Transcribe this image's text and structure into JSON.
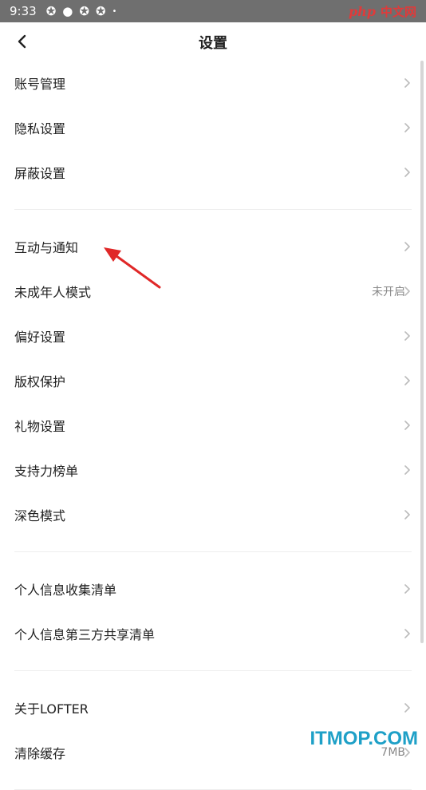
{
  "status": {
    "time": "9:33",
    "dot": "•",
    "watermark_left": "php",
    "watermark_right": "中文网"
  },
  "header": {
    "title": "设置"
  },
  "groups": [
    [
      {
        "label": "账号管理",
        "value": ""
      },
      {
        "label": "隐私设置",
        "value": ""
      },
      {
        "label": "屏蔽设置",
        "value": ""
      }
    ],
    [
      {
        "label": "互动与通知",
        "value": ""
      },
      {
        "label": "未成年人模式",
        "value": "未开启"
      },
      {
        "label": "偏好设置",
        "value": ""
      },
      {
        "label": "版权保护",
        "value": ""
      },
      {
        "label": "礼物设置",
        "value": ""
      },
      {
        "label": "支持力榜单",
        "value": ""
      },
      {
        "label": "深色模式",
        "value": ""
      }
    ],
    [
      {
        "label": "个人信息收集清单",
        "value": ""
      },
      {
        "label": "个人信息第三方共享清单",
        "value": ""
      }
    ],
    [
      {
        "label": "关于LOFTER",
        "value": ""
      },
      {
        "label": "清除缓存",
        "value": "7MB"
      }
    ]
  ],
  "watermark_bottom": "ITMOP.COM",
  "colors": {
    "statusbar": "#6f6f6f",
    "annotation_arrow": "#e02828",
    "watermark_bottom": "#1ea0c7"
  }
}
